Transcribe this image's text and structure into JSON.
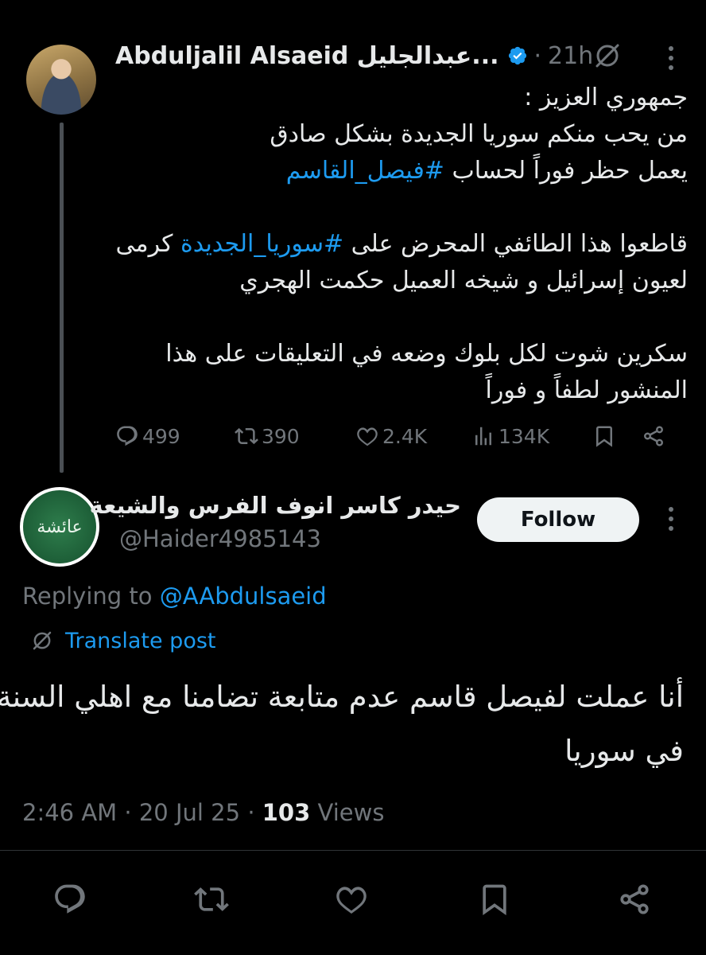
{
  "parent_post": {
    "author_name": "Abduljalil Alsaeid عبدالجليل...",
    "verified": true,
    "separator": "·",
    "time": "21h",
    "body_lines_1": [
      "جمهوري العزيز :",
      "من يحب منكم سوريا الجديدة بشكل صادق"
    ],
    "line3_text": "يعمل حظر فوراً لحساب ",
    "line3_hashtag": "#فيصل_القاسم",
    "line4_text_a": "قاطعوا هذا الطائفي المحرض على ",
    "line4_hashtag": "#سوريا_الجديدة",
    "line4_text_b": " كرمى",
    "line5": "لعيون إسرائيل و شيخه العميل حكمت الهجري",
    "line6": "سكرين شوت لكل بلوك وضعه في التعليقات على هذا",
    "line7": "المنشور لطفاً و فوراً",
    "stats": {
      "replies": "499",
      "reposts": "390",
      "likes": "2.4K",
      "views": "134K"
    }
  },
  "reply_post": {
    "author_name": "حيدر كاسر انوف الفرس والشيعة",
    "handle": "@Haider4985143",
    "follow_label": "Follow",
    "avatar_text": "عائشة",
    "replying_prefix": "Replying to ",
    "replying_mention": "@AAbdulsaeid",
    "translate_label": "Translate post",
    "body_lines": [
      "أنا عملت لفيصل قاسم عدم متابعة تضامنا مع اهلي السنة",
      "في سوريا"
    ],
    "time": "2:46 AM",
    "date": "20 Jul 25",
    "separator": "·",
    "views_count": "103",
    "views_label": " Views"
  },
  "icons": {
    "verified": "verified-badge-icon",
    "grok": "grok-icon",
    "more": "more-icon",
    "reply": "reply-icon",
    "repost": "repost-icon",
    "like": "like-icon",
    "views": "views-icon",
    "bookmark": "bookmark-icon",
    "share": "share-icon"
  },
  "colors": {
    "background": "#000000",
    "text": "#e7e9ea",
    "secondary": "#71767b",
    "accent": "#1d9bf0",
    "button_bg": "#eff3f4"
  }
}
